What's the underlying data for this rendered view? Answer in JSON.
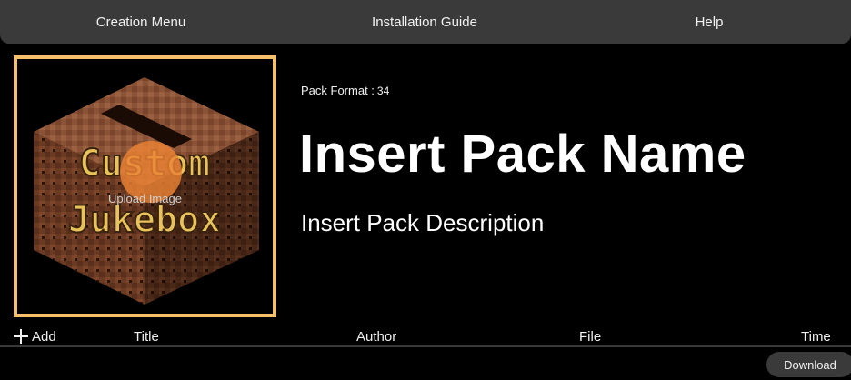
{
  "nav": {
    "creation_menu": "Creation Menu",
    "installation_guide": "Installation Guide",
    "help": "Help"
  },
  "pack_image": {
    "logo_text": [
      "Custom",
      "Jukebox"
    ],
    "upload_label": "Upload Image"
  },
  "pack": {
    "format_label": "Pack Format :",
    "format_value": "34",
    "name": "Insert Pack Name",
    "description": "Insert Pack Description"
  },
  "table": {
    "add_label": "Add",
    "columns": [
      "Title",
      "Author",
      "File",
      "Time"
    ]
  },
  "download_label": "Download",
  "colors": {
    "background": "#000000",
    "nav_bg": "#3a3a3a",
    "image_border": "#f6c06a",
    "upload_circle": "#ec8234"
  }
}
